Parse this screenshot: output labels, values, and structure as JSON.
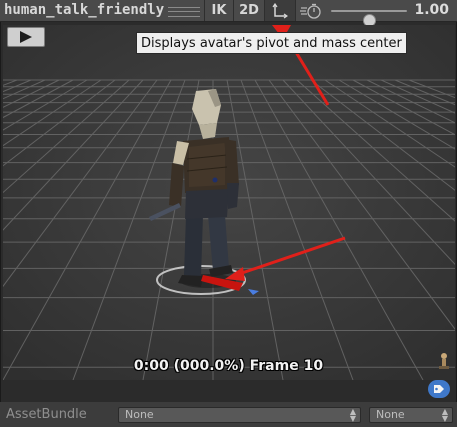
{
  "toolbar": {
    "title": "human_talk_friendly",
    "ik_label": "IK",
    "twod_label": "2D",
    "speed_value": "1.00",
    "speed_fraction": 0.5,
    "icons": [
      "drag-handle-icon",
      "pivot-icon",
      "playback-speed-icon"
    ]
  },
  "viewport": {
    "play_icon": "play-icon",
    "tooltip": "Displays avatar's pivot and mass center",
    "frame_info": "0:00 (000.0%) Frame 10",
    "icons": [
      "avatar-pivot-icon",
      "tag-icon"
    ]
  },
  "assetbundle": {
    "label": "AssetBundle",
    "name_value": "None",
    "variant_value": "None"
  },
  "colors": {
    "annotation_arrow": "#e0201a",
    "toolbar": "#4a4a4a",
    "viewport": "#3b3b3b",
    "grid": "#6a6a6a",
    "tag": "#3f78c9"
  }
}
